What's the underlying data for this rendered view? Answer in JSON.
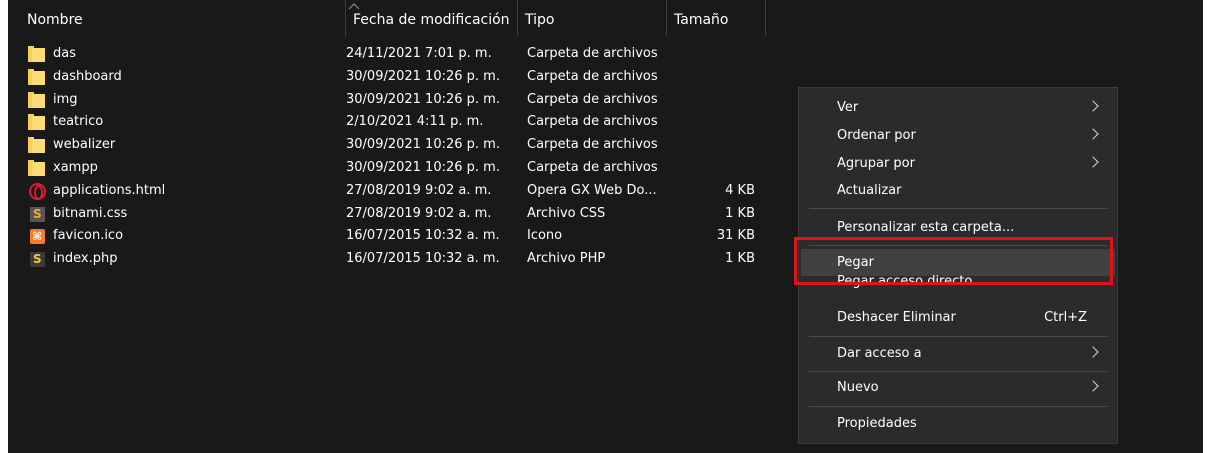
{
  "columns": {
    "name": "Nombre",
    "date": "Fecha de modificación",
    "type": "Tipo",
    "size": "Tamaño"
  },
  "files": [
    {
      "name": "das",
      "date": "24/11/2021 7:01 p. m.",
      "type": "Carpeta de archivos",
      "size": "",
      "icon": "folder-icon"
    },
    {
      "name": "dashboard",
      "date": "30/09/2021 10:26 p. m.",
      "type": "Carpeta de archivos",
      "size": "",
      "icon": "folder-icon"
    },
    {
      "name": "img",
      "date": "30/09/2021 10:26 p. m.",
      "type": "Carpeta de archivos",
      "size": "",
      "icon": "folder-icon"
    },
    {
      "name": "teatrico",
      "date": "2/10/2021 4:11 p. m.",
      "type": "Carpeta de archivos",
      "size": "",
      "icon": "folder-icon"
    },
    {
      "name": "webalizer",
      "date": "30/09/2021 10:26 p. m.",
      "type": "Carpeta de archivos",
      "size": "",
      "icon": "folder-icon"
    },
    {
      "name": "xampp",
      "date": "30/09/2021 10:26 p. m.",
      "type": "Carpeta de archivos",
      "size": "",
      "icon": "folder-icon"
    },
    {
      "name": "applications.html",
      "date": "27/08/2019 9:02 a. m.",
      "type": "Opera GX Web Do...",
      "size": "4 KB",
      "icon": "opera-icon"
    },
    {
      "name": "bitnami.css",
      "date": "27/08/2019 9:02 a. m.",
      "type": "Archivo CSS",
      "size": "1 KB",
      "icon": "bitnami-icon"
    },
    {
      "name": "favicon.ico",
      "date": "16/07/2015 10:32 a. m.",
      "type": "Icono",
      "size": "31 KB",
      "icon": "xampp-icon"
    },
    {
      "name": "index.php",
      "date": "16/07/2015 10:32 a. m.",
      "type": "Archivo PHP",
      "size": "1 KB",
      "icon": "php-icon"
    }
  ],
  "context_menu": {
    "view": "Ver",
    "sort_by": "Ordenar por",
    "group_by": "Agrupar por",
    "refresh": "Actualizar",
    "customize": "Personalizar esta carpeta...",
    "paste": "Pegar",
    "paste_shortcut": "Pegar acceso directo",
    "undo_delete": "Deshacer Eliminar",
    "undo_delete_shortcut": "Ctrl+Z",
    "give_access": "Dar acceso a",
    "new": "Nuevo",
    "properties": "Propiedades"
  },
  "colors": {
    "background": "#191919",
    "menu_background": "#2b2b2b",
    "hover": "#414141",
    "highlight_box": "#e2121a",
    "folder": "#ffdc76"
  }
}
